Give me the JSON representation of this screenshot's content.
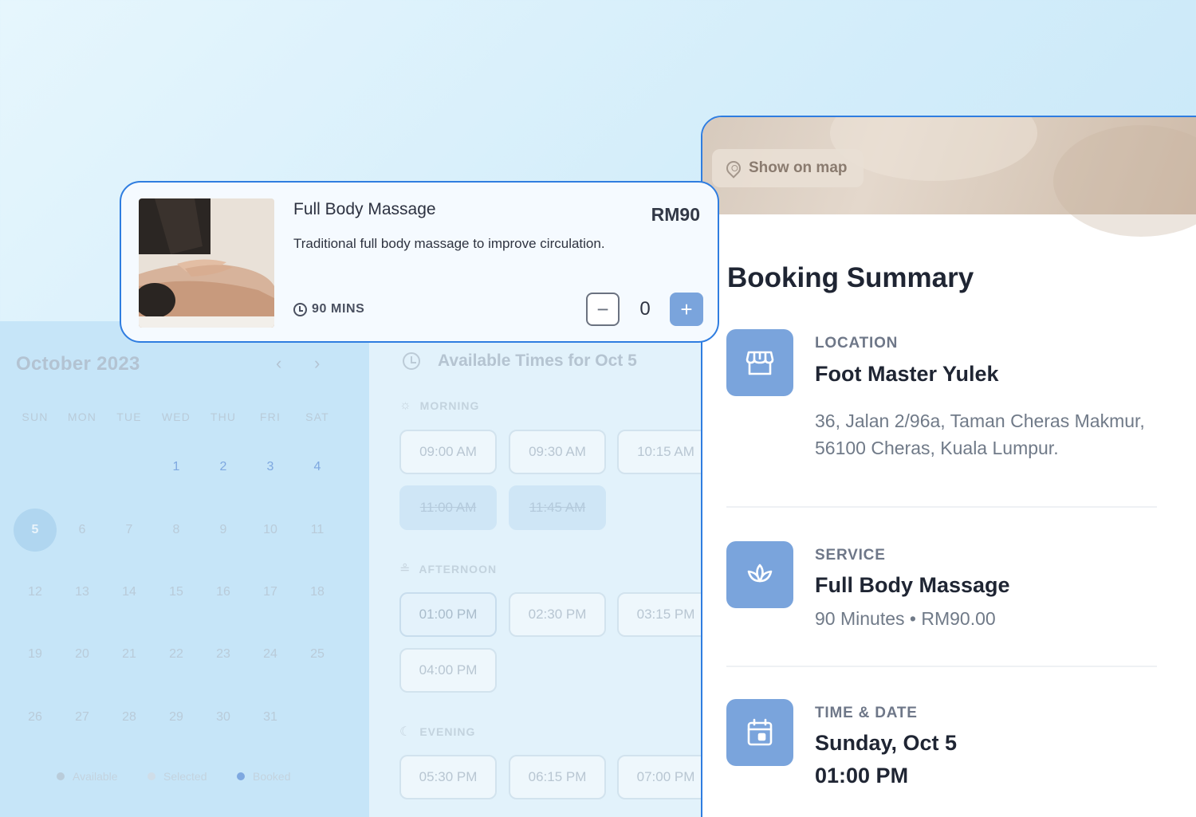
{
  "service_card": {
    "name": "Full Body Massage",
    "price": "RM90",
    "description": "Traditional full body massage to improve circulation.",
    "duration": "90 MINS",
    "quantity": "0",
    "minus_label": "−",
    "plus_label": "+"
  },
  "calendar": {
    "month": "October 2023",
    "prev": "‹",
    "next": "›",
    "weekdays": [
      "SUN",
      "MON",
      "TUE",
      "WED",
      "THU",
      "FRI",
      "SAT"
    ],
    "days": [
      "1",
      "2",
      "3",
      "4",
      "5",
      "6",
      "7",
      "8",
      "9",
      "10",
      "11",
      "12",
      "13",
      "14",
      "15",
      "16",
      "17",
      "18",
      "19",
      "20",
      "21",
      "22",
      "23",
      "24",
      "25",
      "26",
      "27",
      "28",
      "29",
      "30",
      "31"
    ],
    "legend": [
      "Available",
      "Selected",
      "Booked"
    ]
  },
  "times": {
    "title": "Available Times for Oct 5",
    "morning_label": "MORNING",
    "afternoon_label": "AFTERNOON",
    "evening_label": "EVENING",
    "morning": [
      "09:00 AM",
      "09:30 AM",
      "10:15 AM",
      "11:00 AM",
      "11:45 AM"
    ],
    "afternoon": [
      "01:00 PM",
      "02:30 PM",
      "03:15 PM",
      "04:00 PM"
    ],
    "evening": [
      "05:30 PM",
      "06:15 PM",
      "07:00 PM"
    ]
  },
  "summary": {
    "map_button": "Show on map",
    "title": "Booking Summary",
    "location_label": "LOCATION",
    "location_name": "Foot Master Yulek",
    "address_line1": "36, Jalan 2/96a, Taman Cheras Makmur,",
    "address_line2": "56100 Cheras, Kuala Lumpur.",
    "service_label": "SERVICE",
    "service_name": "Full Body Massage",
    "service_details": "90 Minutes • RM90.00",
    "datetime_label": "TIME & DATE",
    "date": "Sunday, Oct 5",
    "time": "01:00 PM"
  },
  "colors": {
    "accent": "#2f7de0",
    "icon_bg": "#7aa4dc"
  }
}
